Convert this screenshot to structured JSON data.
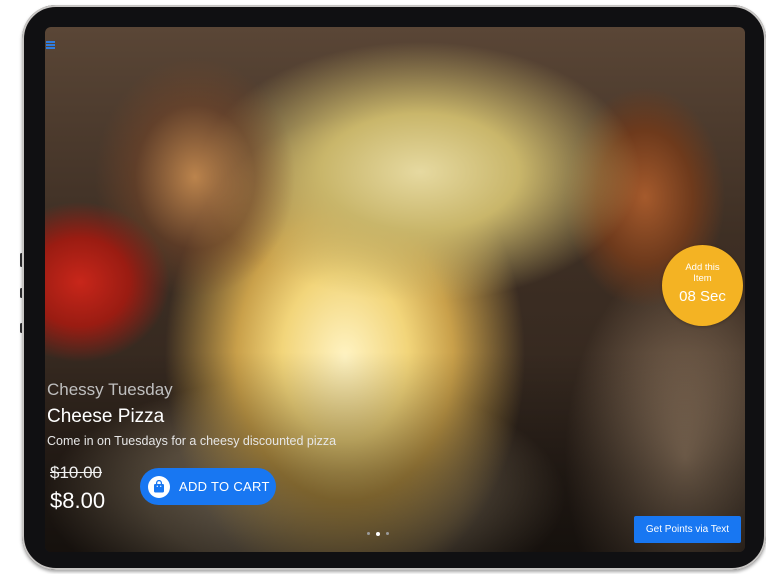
{
  "timer": {
    "title": "Add this Item",
    "countdown": "08 Sec",
    "color": "#f4b323"
  },
  "promo": {
    "subtitle": "Chessy Tuesday",
    "product_name": "Cheese Pizza",
    "description": "Come in on Tuesdays for a cheesy discounted pizza",
    "old_price": "$10.00",
    "new_price": "$8.00"
  },
  "cart_button": {
    "label": "ADD TO CART",
    "icon": "shopping-bag-icon",
    "color": "#1877f2"
  },
  "carousel": {
    "dot_count": 3,
    "active_index": 1
  },
  "points_button": {
    "label": "Get Points via Text",
    "color": "#1877f2"
  },
  "menu": {
    "icon": "hamburger-menu-icon",
    "color": "#2f7de0"
  }
}
